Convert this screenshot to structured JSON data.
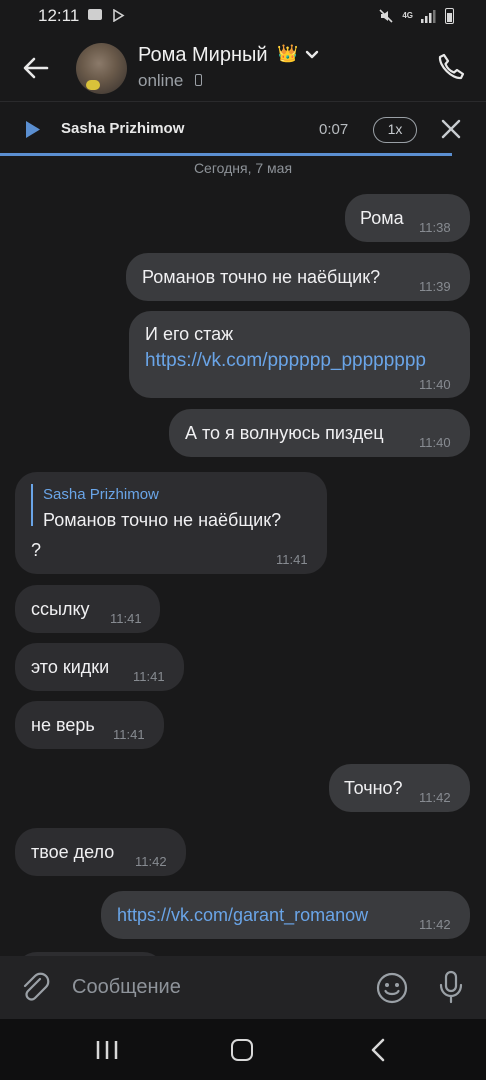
{
  "status_bar": {
    "time": "12:11",
    "network": "4G"
  },
  "header": {
    "contact_name": "Рома Мирный",
    "crown": "👑",
    "status": "online",
    "icons": [
      "back-arrow-icon",
      "chevron-down-icon",
      "phone-call-icon"
    ]
  },
  "player": {
    "track_name": "Sasha Prizhimow",
    "elapsed": "0:07",
    "speed": "1x",
    "progress": 0.93,
    "accent_color": "#5b8fd1"
  },
  "chat": {
    "date_separator": "Сегодня, 7 мая",
    "messages": [
      {
        "dir": "out",
        "text": "Рома",
        "time": "11:38"
      },
      {
        "dir": "out",
        "text": "Романов точно не наёбщик?",
        "time": "11:39"
      },
      {
        "dir": "out",
        "text": "И его стаж",
        "link": "https://vk.com/pppppp_pppppppp",
        "time": "11:40"
      },
      {
        "dir": "out",
        "text": "А то я волнуюсь пиздец",
        "time": "11:40"
      },
      {
        "dir": "in",
        "reply_author": "Sasha Prizhimow",
        "reply_text": "Романов точно не наёбщик?",
        "text": "?",
        "time": "11:41"
      },
      {
        "dir": "in",
        "text": "ссылку",
        "time": "11:41"
      },
      {
        "dir": "in",
        "text": "это кидки",
        "time": "11:41"
      },
      {
        "dir": "in",
        "text": "не верь",
        "time": "11:41"
      },
      {
        "dir": "out",
        "text": "Точно?",
        "time": "11:42"
      },
      {
        "dir": "in",
        "text": "твое дело",
        "time": "11:42"
      },
      {
        "dir": "out",
        "link": "https://vk.com/garant_romanow",
        "time": "11:42"
      }
    ]
  },
  "composer": {
    "placeholder": "Сообщение",
    "icons": [
      "paperclip-icon",
      "emoji-icon",
      "microphone-icon"
    ]
  },
  "nav_bar": {
    "icons": [
      "recents-icon",
      "home-icon",
      "back-icon"
    ]
  }
}
